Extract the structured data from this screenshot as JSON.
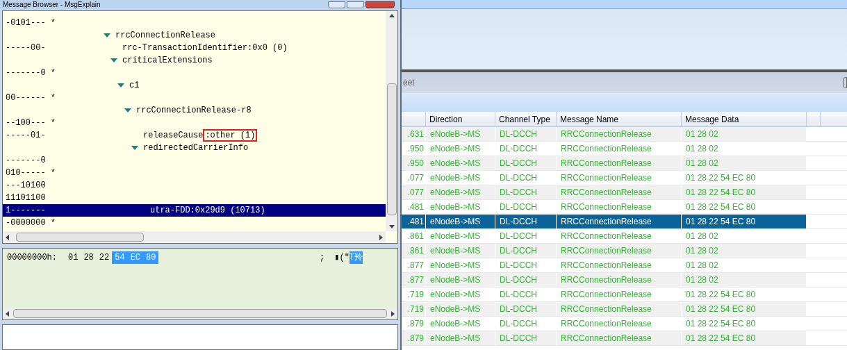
{
  "message_browser": {
    "title": "Message Browser - MsgExplain",
    "tree": [
      {
        "kind": "bits",
        "bits": "-0101--- *",
        "selected": false
      },
      {
        "kind": "node",
        "label": "rrcConnectionRelease",
        "expanded": true,
        "selected": false,
        "children": [
          {
            "kind": "leaf",
            "bits": "-----00-",
            "label": "rrc-TransactionIdentifier:0x0 (0)",
            "selected": false
          },
          {
            "kind": "node",
            "label": "criticalExtensions",
            "expanded": true,
            "selected": false,
            "children": [
              {
                "kind": "bits",
                "bits": "-------0 *",
                "selected": false
              },
              {
                "kind": "node",
                "label": "c1",
                "expanded": true,
                "selected": false,
                "children": [
                  {
                    "kind": "bits",
                    "bits": "00------ *",
                    "selected": false
                  },
                  {
                    "kind": "node",
                    "label": "rrcConnectionRelease-r8",
                    "expanded": true,
                    "selected": false,
                    "children": [
                      {
                        "kind": "bits",
                        "bits": "--100--- *",
                        "selected": false
                      },
                      {
                        "kind": "leaf",
                        "bits": "-----01-",
                        "label": "releaseCause",
                        "boxed_value": ":other (1)",
                        "selected": false
                      },
                      {
                        "kind": "node",
                        "label": "redirectedCarrierInfo",
                        "expanded": true,
                        "selected": false,
                        "children": [
                          {
                            "kind": "bits",
                            "bits": "-------0",
                            "selected": false
                          },
                          {
                            "kind": "bits",
                            "bits": "010----- *",
                            "selected": false
                          },
                          {
                            "kind": "bits",
                            "bits": "---10100",
                            "selected": false
                          },
                          {
                            "kind": "bits",
                            "bits": "11101100",
                            "selected": false
                          },
                          {
                            "kind": "leaf",
                            "bits": "1-------",
                            "label": "utra-FDD:0x29d9 (10713)",
                            "selected": true
                          },
                          {
                            "kind": "bits",
                            "bits": "-0000000 *",
                            "selected": false
                          }
                        ]
                      }
                    ]
                  }
                ]
              }
            ]
          }
        ]
      }
    ],
    "hex": {
      "offset": "00000000h:",
      "bytes": [
        {
          "text": "01",
          "selected": false
        },
        {
          "text": "28",
          "selected": false
        },
        {
          "text": "22",
          "selected": false
        },
        {
          "text": "54",
          "selected": true
        },
        {
          "text": "EC",
          "selected": true
        },
        {
          "text": "80",
          "selected": true
        }
      ],
      "separator": ";",
      "ascii": [
        {
          "text": "▮(\"",
          "selected": false
        },
        {
          "text": "T羚",
          "selected": true
        }
      ]
    }
  },
  "main": {
    "tab_label": "eet",
    "table": {
      "columns": [
        "",
        "Direction",
        "Channel Type",
        "Message Name",
        "Message Data"
      ],
      "rows": [
        {
          "cells": [
            ".631",
            "eNodeB->MS",
            "DL-DCCH",
            "RRCConnectionRelease",
            "01 28 02"
          ],
          "selected": false
        },
        {
          "cells": [
            ".950",
            "eNodeB->MS",
            "DL-DCCH",
            "RRCConnectionRelease",
            "01 28 02"
          ],
          "selected": false
        },
        {
          "cells": [
            ".950",
            "eNodeB->MS",
            "DL-DCCH",
            "RRCConnectionRelease",
            "01 28 02"
          ],
          "selected": false
        },
        {
          "cells": [
            ".077",
            "eNodeB->MS",
            "DL-DCCH",
            "RRCConnectionRelease",
            "01 28 22 54 EC 80"
          ],
          "selected": false
        },
        {
          "cells": [
            ".077",
            "eNodeB->MS",
            "DL-DCCH",
            "RRCConnectionRelease",
            "01 28 22 54 EC 80"
          ],
          "selected": false
        },
        {
          "cells": [
            ".481",
            "eNodeB->MS",
            "DL-DCCH",
            "RRCConnectionRelease",
            "01 28 22 54 EC 80"
          ],
          "selected": false
        },
        {
          "cells": [
            ".481",
            "eNodeB->MS",
            "DL-DCCH",
            "RRCConnectionRelease",
            "01 28 22 54 EC 80"
          ],
          "selected": true
        },
        {
          "cells": [
            ".861",
            "eNodeB->MS",
            "DL-DCCH",
            "RRCConnectionRelease",
            "01 28 02"
          ],
          "selected": false
        },
        {
          "cells": [
            ".861",
            "eNodeB->MS",
            "DL-DCCH",
            "RRCConnectionRelease",
            "01 28 02"
          ],
          "selected": false
        },
        {
          "cells": [
            ".877",
            "eNodeB->MS",
            "DL-DCCH",
            "RRCConnectionRelease",
            "01 28 02"
          ],
          "selected": false
        },
        {
          "cells": [
            ".877",
            "eNodeB->MS",
            "DL-DCCH",
            "RRCConnectionRelease",
            "01 28 02"
          ],
          "selected": false
        },
        {
          "cells": [
            ".719",
            "eNodeB->MS",
            "DL-DCCH",
            "RRCConnectionRelease",
            "01 28 22 54 EC 80"
          ],
          "selected": false
        },
        {
          "cells": [
            ".719",
            "eNodeB->MS",
            "DL-DCCH",
            "RRCConnectionRelease",
            "01 28 22 54 EC 80"
          ],
          "selected": false
        },
        {
          "cells": [
            ".879",
            "eNodeB->MS",
            "DL-DCCH",
            "RRCConnectionRelease",
            "01 28 22 54 EC 80"
          ],
          "selected": false
        },
        {
          "cells": [
            ".879",
            "eNodeB->MS",
            "DL-DCCH",
            "RRCConnectionRelease",
            "01 28 22 54 EC 80"
          ],
          "selected": false
        }
      ]
    }
  }
}
